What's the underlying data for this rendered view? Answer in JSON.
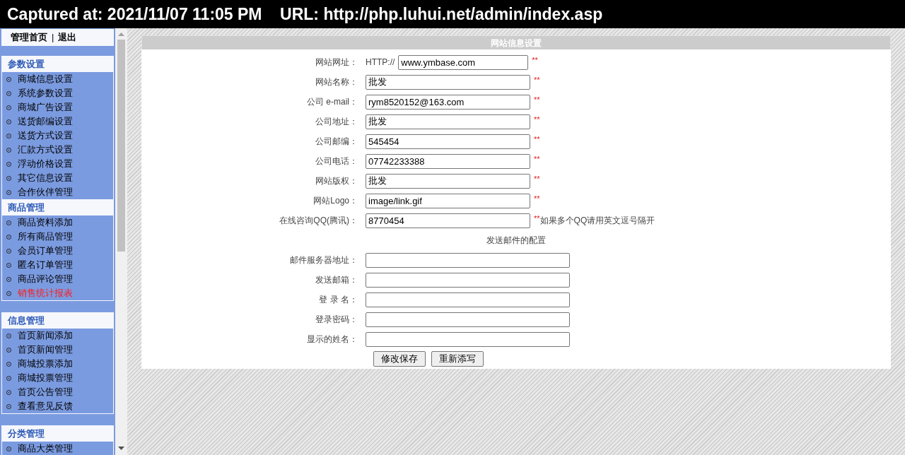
{
  "capture_bar": {
    "text": "Captured at: 2021/11/07 11:05 PM    URL: http://php.luhui.net/admin/index.asp"
  },
  "top_links": {
    "items": [
      "管理首页",
      "退出"
    ],
    "separator": "|"
  },
  "sidebar": {
    "groups": [
      {
        "title": "参数设置",
        "items": [
          {
            "label": "商城信息设置",
            "selected": false
          },
          {
            "label": "系统参数设置",
            "selected": false
          },
          {
            "label": "商城广告设置",
            "selected": false
          },
          {
            "label": "送货邮编设置",
            "selected": false
          },
          {
            "label": "送货方式设置",
            "selected": false
          },
          {
            "label": "汇款方式设置",
            "selected": false
          },
          {
            "label": "浮动价格设置",
            "selected": false
          },
          {
            "label": "其它信息设置",
            "selected": false
          },
          {
            "label": "合作伙伴管理",
            "selected": false
          }
        ]
      },
      {
        "title": "商品管理",
        "items": [
          {
            "label": "商品资料添加",
            "selected": false
          },
          {
            "label": "所有商品管理",
            "selected": false
          },
          {
            "label": "会员订单管理",
            "selected": false
          },
          {
            "label": "匿名订单管理",
            "selected": false
          },
          {
            "label": "商品评论管理",
            "selected": false
          },
          {
            "label": "销售统计报表",
            "selected": true
          }
        ]
      },
      {
        "title": "信息管理",
        "items": [
          {
            "label": "首页新闻添加",
            "selected": false
          },
          {
            "label": "首页新闻管理",
            "selected": false
          },
          {
            "label": "商城投票添加",
            "selected": false
          },
          {
            "label": "商城投票管理",
            "selected": false
          },
          {
            "label": "首页公告管理",
            "selected": false
          },
          {
            "label": "查看意见反馈",
            "selected": false
          }
        ]
      },
      {
        "title": "分类管理",
        "items": [
          {
            "label": "商品大类管理",
            "selected": false
          }
        ]
      }
    ]
  },
  "form": {
    "title": "网站信息设置",
    "fields": [
      {
        "label": "网站网址：",
        "prefix": "HTTP://",
        "value": "www.ymbase.com",
        "required_mark": "**"
      },
      {
        "label": "网站名称：",
        "value": "批发",
        "required_mark": "**"
      },
      {
        "label": "公司 e-mail：",
        "value": "rym8520152@163.com",
        "required_mark": "**"
      },
      {
        "label": "公司地址：",
        "value": "批发",
        "required_mark": "**"
      },
      {
        "label": "公司邮编：",
        "value": "545454",
        "required_mark": "**"
      },
      {
        "label": "公司电话：",
        "value": "07742233388",
        "required_mark": "**"
      },
      {
        "label": "网站版权：",
        "value": "批发",
        "required_mark": "**"
      },
      {
        "label": "网站Logo：",
        "value": "image/link.gif",
        "required_mark": "**"
      },
      {
        "label": "在线咨询QQ(腾讯)：",
        "value": "8770454",
        "required_mark": "**",
        "note": "如果多个QQ请用英文逗号隔开"
      }
    ],
    "section_title": "发送邮件的配置",
    "mail_fields": [
      {
        "label": "邮件服务器地址："
      },
      {
        "label": "发送邮箱："
      },
      {
        "label": "登 录 名："
      },
      {
        "label": "登录密码："
      },
      {
        "label": "显示的姓名："
      }
    ],
    "buttons": [
      "修改保存",
      "重新添写"
    ]
  }
}
